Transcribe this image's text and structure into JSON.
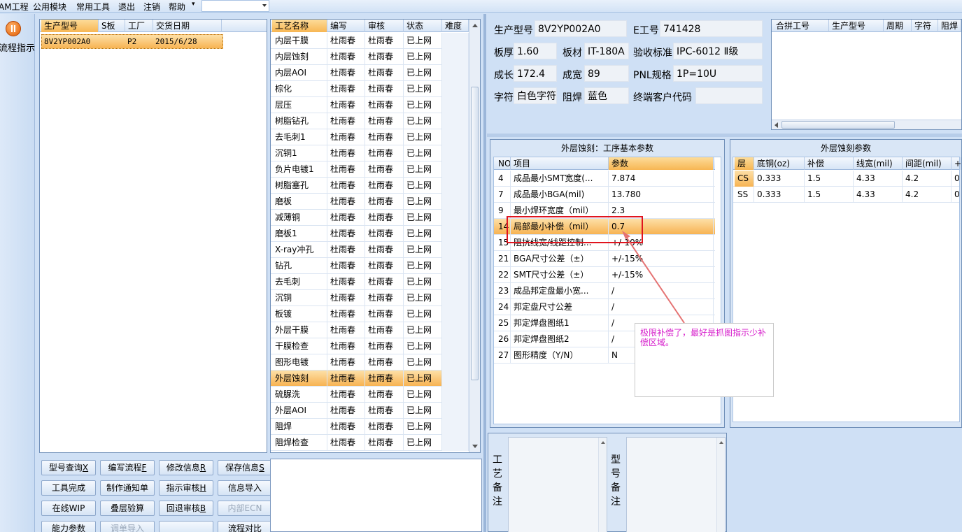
{
  "menu": {
    "items": [
      "AM工程",
      "公用模块",
      "常用工具",
      "退出",
      "注销",
      "帮助"
    ],
    "combo_value": ""
  },
  "left_strip": {
    "flow_label": "流程指示"
  },
  "model_list": {
    "headers": [
      "生产型号",
      "S板",
      "工厂",
      "交货日期"
    ],
    "rows": [
      {
        "model": "8V2YP002A0",
        "s": "",
        "factory": "P2",
        "date": "2015/6/28"
      }
    ]
  },
  "process_list": {
    "headers": [
      "工艺名称",
      "编写",
      "审核",
      "状态",
      "难度"
    ],
    "rows": [
      [
        "内层干膜",
        "杜雨春",
        "杜雨春",
        "已上网",
        ""
      ],
      [
        "内层蚀刻",
        "杜雨春",
        "杜雨春",
        "已上网",
        ""
      ],
      [
        "内层AOI",
        "杜雨春",
        "杜雨春",
        "已上网",
        ""
      ],
      [
        "棕化",
        "杜雨春",
        "杜雨春",
        "已上网",
        ""
      ],
      [
        "层压",
        "杜雨春",
        "杜雨春",
        "已上网",
        ""
      ],
      [
        "树脂钻孔",
        "杜雨春",
        "杜雨春",
        "已上网",
        ""
      ],
      [
        "去毛刺1",
        "杜雨春",
        "杜雨春",
        "已上网",
        ""
      ],
      [
        "沉铜1",
        "杜雨春",
        "杜雨春",
        "已上网",
        ""
      ],
      [
        "负片电镀1",
        "杜雨春",
        "杜雨春",
        "已上网",
        ""
      ],
      [
        "树脂塞孔",
        "杜雨春",
        "杜雨春",
        "已上网",
        ""
      ],
      [
        "磨板",
        "杜雨春",
        "杜雨春",
        "已上网",
        ""
      ],
      [
        "减薄铜",
        "杜雨春",
        "杜雨春",
        "已上网",
        ""
      ],
      [
        "磨板1",
        "杜雨春",
        "杜雨春",
        "已上网",
        ""
      ],
      [
        "X-ray冲孔",
        "杜雨春",
        "杜雨春",
        "已上网",
        ""
      ],
      [
        "钻孔",
        "杜雨春",
        "杜雨春",
        "已上网",
        ""
      ],
      [
        "去毛刺",
        "杜雨春",
        "杜雨春",
        "已上网",
        ""
      ],
      [
        "沉铜",
        "杜雨春",
        "杜雨春",
        "已上网",
        ""
      ],
      [
        "板镀",
        "杜雨春",
        "杜雨春",
        "已上网",
        ""
      ],
      [
        "外层干膜",
        "杜雨春",
        "杜雨春",
        "已上网",
        ""
      ],
      [
        "干膜检查",
        "杜雨春",
        "杜雨春",
        "已上网",
        ""
      ],
      [
        "图形电镀",
        "杜雨春",
        "杜雨春",
        "已上网",
        ""
      ],
      [
        "外层蚀刻",
        "杜雨春",
        "杜雨春",
        "已上网",
        ""
      ],
      [
        "硫脲洗",
        "杜雨春",
        "杜雨春",
        "已上网",
        ""
      ],
      [
        "外层AOI",
        "杜雨春",
        "杜雨春",
        "已上网",
        ""
      ],
      [
        "阻焊",
        "杜雨春",
        "杜雨春",
        "已上网",
        ""
      ],
      [
        "阻焊检查",
        "杜雨春",
        "杜雨春",
        "已上网",
        ""
      ]
    ],
    "selected_index": 21
  },
  "buttons": [
    {
      "label": "型号查询",
      "key": "X",
      "disabled": false
    },
    {
      "label": "编写流程",
      "key": "F",
      "disabled": false
    },
    {
      "label": "修改信息",
      "key": "R",
      "disabled": false
    },
    {
      "label": "保存信息",
      "key": "S",
      "disabled": false
    },
    {
      "label": "工具完成",
      "key": "",
      "disabled": false
    },
    {
      "label": "制作通知单",
      "key": "",
      "disabled": false
    },
    {
      "label": "指示审核",
      "key": "H",
      "disabled": false
    },
    {
      "label": "信息导入",
      "key": "",
      "disabled": false
    },
    {
      "label": "在线WIP",
      "key": "",
      "disabled": false
    },
    {
      "label": "叠层验算",
      "key": "",
      "disabled": false
    },
    {
      "label": "回退审核",
      "key": "B",
      "disabled": false
    },
    {
      "label": "内部ECN",
      "key": "",
      "disabled": true
    },
    {
      "label": "能力参数",
      "key": "",
      "disabled": false
    },
    {
      "label": "调单导入",
      "key": "",
      "disabled": true
    },
    {
      "label": "",
      "key": "",
      "disabled": false
    },
    {
      "label": "流程对比",
      "key": "",
      "disabled": false
    }
  ],
  "info": {
    "model_label": "生产型号",
    "model_value": "8V2YP002A0",
    "e_label": "E工号",
    "e_value": "741428",
    "thick_label": "板厚",
    "thick_value": "1.60",
    "material_label": "板材",
    "material_value": "IT-180A",
    "std_label": "验收标准",
    "std_value": "IPC-6012 Ⅱ级",
    "len_label": "成长",
    "len_value": "172.4",
    "wid_label": "成宽",
    "wid_value": "89",
    "pnl_label": "PNL规格",
    "pnl_value": "1P=10U",
    "char_label": "字符",
    "char_value": "白色字符",
    "mask_label": "阻焊",
    "mask_value": "蓝色",
    "cust_label": "终端客户代码",
    "cust_value": ""
  },
  "merge_grid": {
    "headers": [
      "合拼工号",
      "生产型号",
      "周期",
      "字符",
      "阻焊"
    ]
  },
  "params": {
    "title": "外层蚀刻：工序基本参数",
    "headers": [
      "NO",
      "项目",
      "参数"
    ],
    "rows": [
      [
        "4",
        "成品最小SMT宽度(...",
        "7.874"
      ],
      [
        "7",
        "成品最小BGA(mil)",
        "13.780"
      ],
      [
        "9",
        "最小焊环宽度（mil）",
        "2.3"
      ],
      [
        "14",
        "局部最小补偿（mil）",
        "0.7"
      ],
      [
        "15",
        "阻抗线宽/线距控制...",
        "+/-10%"
      ],
      [
        "21",
        "BGA尺寸公差（±）",
        "+/-15%"
      ],
      [
        "22",
        "SMT尺寸公差（±）",
        "+/-15%"
      ],
      [
        "23",
        "成品邦定盘最小宽...",
        "/"
      ],
      [
        "24",
        "邦定盘尺寸公差",
        "/"
      ],
      [
        "25",
        "邦定焊盘图纸1",
        "/"
      ],
      [
        "26",
        "邦定焊盘图纸2",
        "/"
      ],
      [
        "27",
        "图形精度（Y/N）",
        "N"
      ]
    ],
    "selected_index": 3
  },
  "etch": {
    "title": "外层蚀刻参数",
    "headers": [
      "层",
      "底铜(oz)",
      "补偿",
      "线宽(mil)",
      "间距(mil)",
      "+"
    ],
    "rows": [
      [
        "CS",
        "0.333",
        "1.5",
        "4.33",
        "4.2",
        "0"
      ],
      [
        "SS",
        "0.333",
        "1.5",
        "4.33",
        "4.2",
        "0"
      ]
    ]
  },
  "annotation": {
    "text": "极限补偿了，最好是抓图指示少补偿区域。"
  },
  "remarks": {
    "process_label": "工艺备注",
    "model_label": "型号备注"
  }
}
